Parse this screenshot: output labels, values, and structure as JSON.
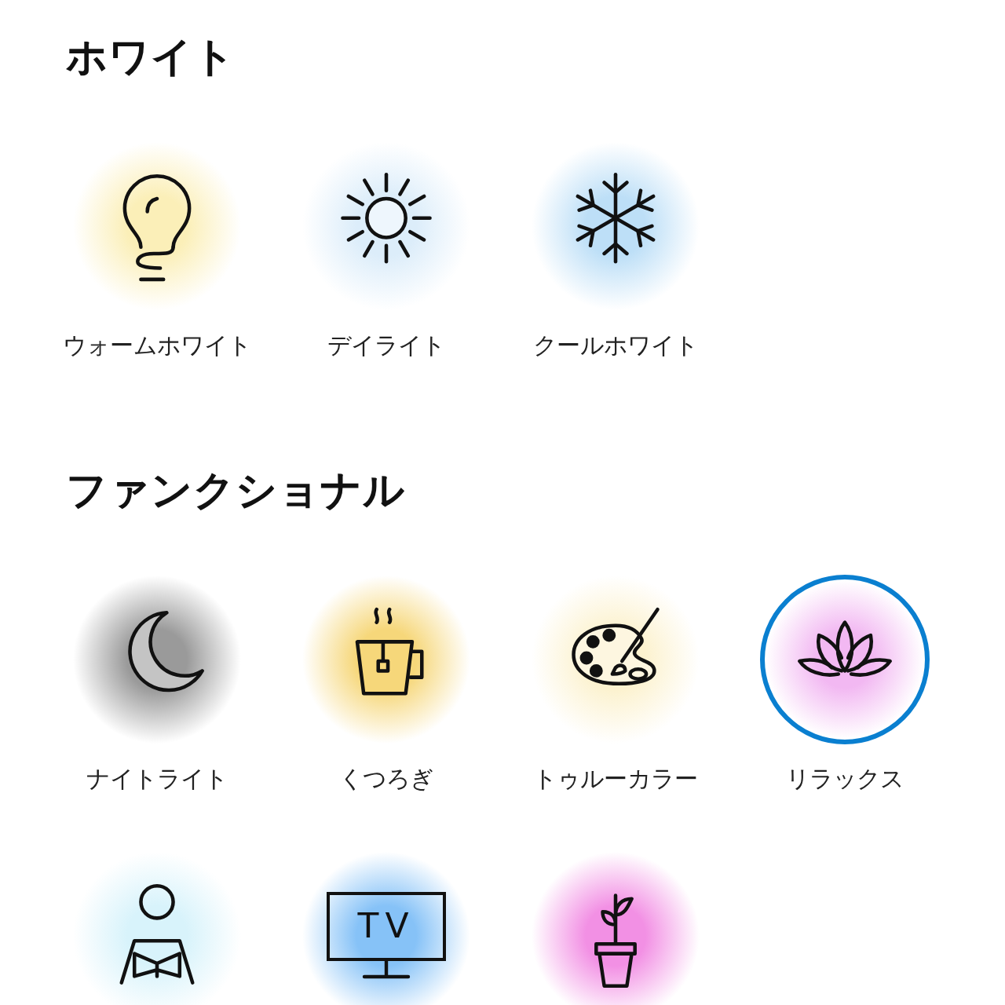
{
  "sections": [
    {
      "title": "ホワイト",
      "items": [
        {
          "kind": "bulb",
          "label": "ウォームホワイト",
          "color": "#fbefb8",
          "selected": false
        },
        {
          "kind": "sun",
          "label": "デイライト",
          "color": "#dcedfa",
          "selected": false
        },
        {
          "kind": "snowflake",
          "label": "クールホワイト",
          "color": "#bddff7",
          "selected": false
        }
      ]
    },
    {
      "title": "ファンクショナル",
      "items": [
        {
          "kind": "moon",
          "label": "ナイトライト",
          "color": "#9a9a9a",
          "selected": false
        },
        {
          "kind": "tea",
          "label": "くつろぎ",
          "color": "#f6d77a",
          "selected": false
        },
        {
          "kind": "palette",
          "label": "トゥルーカラー",
          "color": "#fcf2cf",
          "selected": false
        },
        {
          "kind": "lotus",
          "label": "リラックス",
          "color": "#f2b8f2",
          "selected": true
        },
        {
          "kind": "reader",
          "color": "#d8f3fb",
          "selected": false
        },
        {
          "kind": "tv",
          "screen_text": "TV",
          "color": "#86c2f7",
          "selected": false
        },
        {
          "kind": "plant",
          "color": "#f290e4",
          "selected": false
        }
      ]
    }
  ]
}
